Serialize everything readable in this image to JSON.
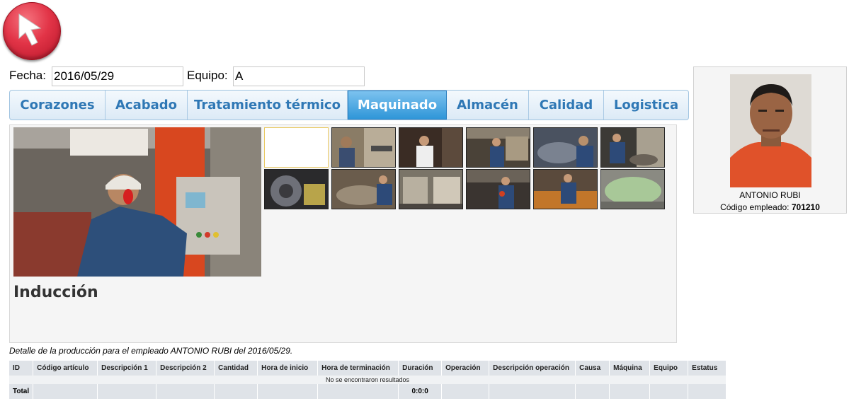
{
  "form": {
    "fecha_label": "Fecha:",
    "fecha_value": "2016/05/29",
    "equipo_label": "Equipo:",
    "equipo_value": "A"
  },
  "tabs": [
    {
      "label": "Corazones",
      "active": false
    },
    {
      "label": "Acabado",
      "active": false
    },
    {
      "label": "Tratamiento térmico",
      "active": false
    },
    {
      "label": "Maquinado",
      "active": true
    },
    {
      "label": "Almacén",
      "active": false
    },
    {
      "label": "Calidad",
      "active": false
    },
    {
      "label": "Logistica",
      "active": false
    }
  ],
  "station": {
    "title": "Inducción"
  },
  "employee": {
    "name": "ANTONIO RUBI",
    "code_label": "Código empleado:",
    "code": "701210"
  },
  "detail": {
    "caption": "Detalle de la producción para el empleado ANTONIO RUBI del 2016/05/29.",
    "columns": [
      "ID",
      "Código artículo",
      "Descripción 1",
      "Descripción 2",
      "Cantidad",
      "Hora de inicio",
      "Hora de terminación",
      "Duración",
      "Operación",
      "Descripción operación",
      "Causa",
      "Máquina",
      "Equipo",
      "Estatus"
    ],
    "empty_message": "No se encontraron resultados",
    "total_label": "Total",
    "total_duration": "0:0:0"
  },
  "colors": {
    "tab_text": "#2f78b5",
    "tab_active_bg": "#2f96d8",
    "back_button": "#e23447"
  },
  "icons": {
    "back_button": "arrow-cursor-icon"
  }
}
